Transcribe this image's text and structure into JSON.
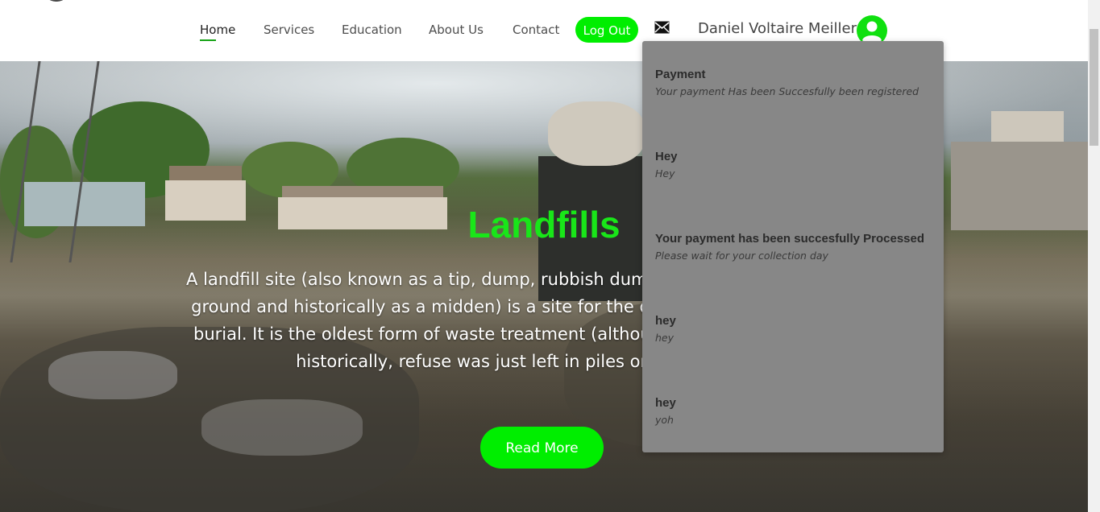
{
  "nav": {
    "items": [
      {
        "label": "Home",
        "active": true
      },
      {
        "label": "Services"
      },
      {
        "label": "Education"
      },
      {
        "label": "About Us"
      },
      {
        "label": "Contact"
      }
    ],
    "logout_label": "Log Out",
    "mail_icon": "envelope-icon",
    "user_name": "Daniel Voltaire Meiller",
    "avatar_icon": "user-circle-icon"
  },
  "hero": {
    "title": "Landfills",
    "text": "A landfill site (also known as a tip, dump, rubbish dump, garbage dump, or dumping ground and historically as a midden) is a site for the disposal of waste materials by burial. It is the oldest form of waste treatment (although the burial part is modern; historically, refuse was just left in piles or thrown into pits)",
    "button_label": "Read More"
  },
  "notifications": [
    {
      "title": "Payment",
      "message": "Your payment Has been Succesfully been registered"
    },
    {
      "title": "Hey",
      "message": "Hey"
    },
    {
      "title": "Your payment has been succesfully Processed",
      "message": "Please wait for your collection day"
    },
    {
      "title": "hey",
      "message": "hey"
    },
    {
      "title": "hey",
      "message": "yoh"
    }
  ],
  "colors": {
    "accent": "#00ee00",
    "title_green": "#19e619",
    "panel_bg": "#878787"
  }
}
